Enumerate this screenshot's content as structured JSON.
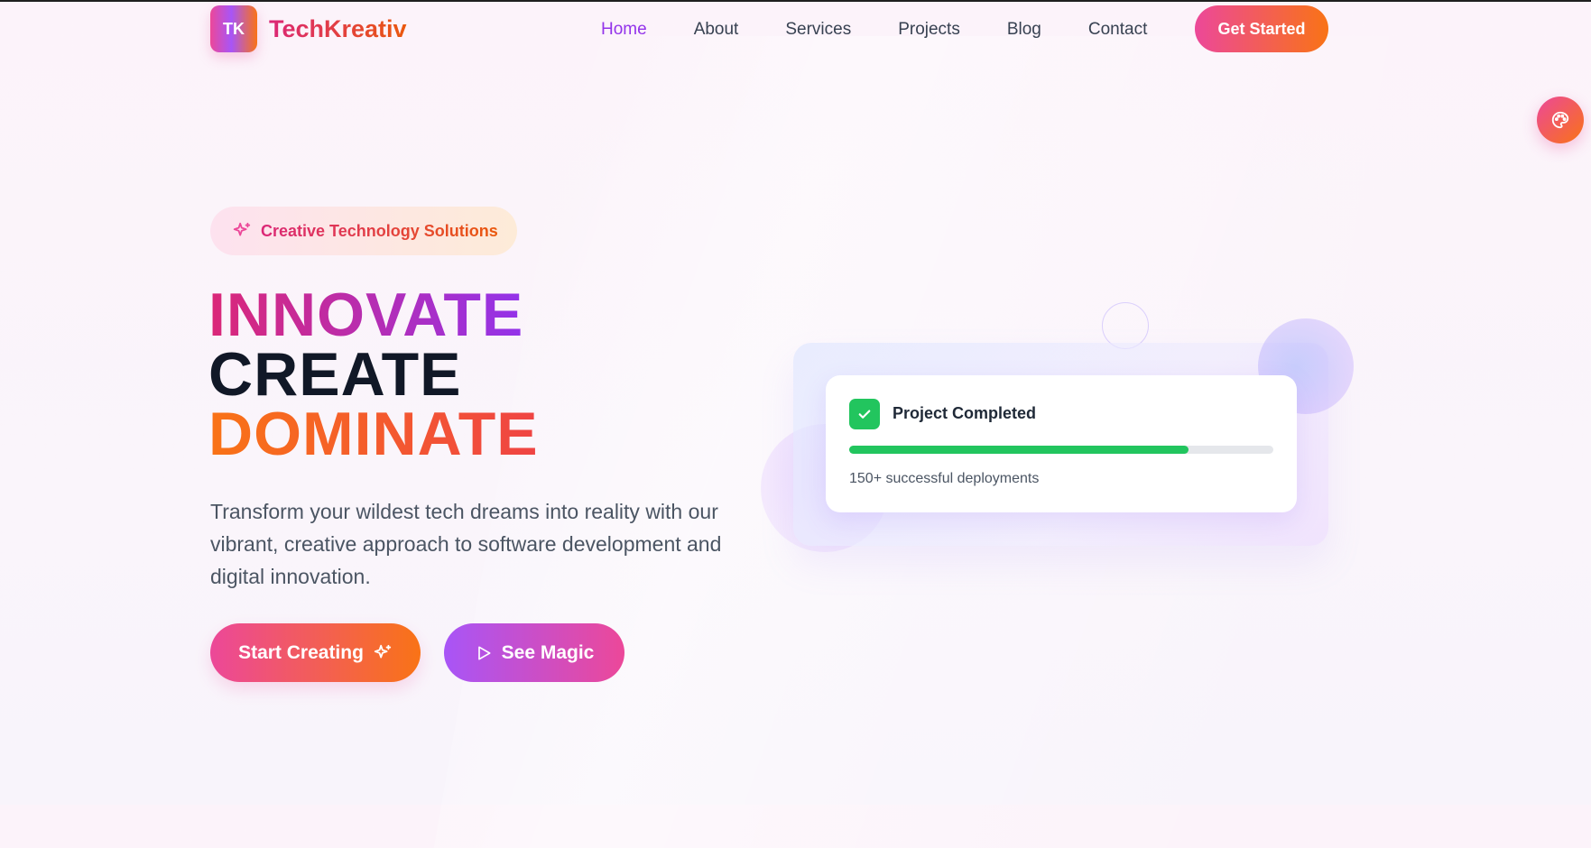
{
  "header": {
    "logo_initials": "TK",
    "brand": "TechKreativ",
    "nav": [
      {
        "label": "Home",
        "active": true
      },
      {
        "label": "About"
      },
      {
        "label": "Services"
      },
      {
        "label": "Projects"
      },
      {
        "label": "Blog"
      },
      {
        "label": "Contact"
      }
    ],
    "cta": "Get Started"
  },
  "floating_button": {
    "icon": "palette-icon"
  },
  "hero": {
    "badge": {
      "icon": "sparkles-icon",
      "text": "Creative Technology Solutions"
    },
    "headline": [
      "INNOVATE",
      "CREATE",
      "DOMINATE"
    ],
    "description": "Transform your wildest tech dreams into reality with our vibrant, creative approach to software development and digital innovation.",
    "primary_button": {
      "label": "Start Creating",
      "icon": "sparkles-icon"
    },
    "secondary_button": {
      "label": "See Magic",
      "icon": "play-icon"
    }
  },
  "status_card": {
    "icon": "check-icon",
    "title": "Project Completed",
    "progress": 0.8,
    "subtitle": "150+ successful deployments"
  },
  "colors": {
    "accent_pink": "#ec4899",
    "accent_orange": "#f97316",
    "accent_purple": "#a855f7",
    "success_green": "#22c55e",
    "nav_active": "#9333ea"
  }
}
